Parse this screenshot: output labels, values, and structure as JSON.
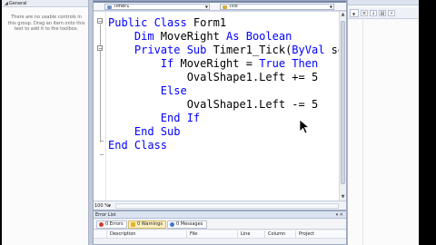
{
  "toolbox": {
    "title": "General",
    "empty_message": "There are no usable controls in\nthis group. Drag an item onto this\ntext to add it to the toolbox."
  },
  "editor": {
    "object_combo": "Timer1",
    "event_combo": "Tick",
    "zoom": "100 %",
    "code_lines": [
      {
        "tokens": [
          {
            "t": "Public Class ",
            "kw": true
          },
          {
            "t": "Form1",
            "kw": false
          }
        ]
      },
      {
        "tokens": [
          {
            "t": "    Dim ",
            "kw": true
          },
          {
            "t": "MoveRight ",
            "kw": false
          },
          {
            "t": "As Boolean",
            "kw": true
          }
        ]
      },
      {
        "tokens": [
          {
            "t": "    Private Sub ",
            "kw": true
          },
          {
            "t": "Timer1_Tick(",
            "kw": false
          },
          {
            "t": "ByVal",
            "kw": true
          },
          {
            "t": " se",
            "kw": false
          }
        ]
      },
      {
        "tokens": [
          {
            "t": "        If ",
            "kw": true
          },
          {
            "t": "MoveRight = ",
            "kw": false
          },
          {
            "t": "True Then",
            "kw": true
          }
        ]
      },
      {
        "tokens": [
          {
            "t": "            OvalShape1.Left += 5",
            "kw": false
          }
        ]
      },
      {
        "tokens": [
          {
            "t": "        Else",
            "kw": true
          }
        ]
      },
      {
        "tokens": [
          {
            "t": "            OvalShape1.Left -= 5",
            "kw": false
          }
        ]
      },
      {
        "tokens": [
          {
            "t": "        End If",
            "kw": true
          }
        ]
      },
      {
        "tokens": [
          {
            "t": "    End Sub",
            "kw": true
          }
        ]
      },
      {
        "tokens": [
          {
            "t": "End Class",
            "kw": true
          }
        ]
      }
    ]
  },
  "error_list": {
    "title": "Error List",
    "tabs": {
      "errors": "0 Errors",
      "warnings": "0 Warnings",
      "messages": "0 Messages"
    },
    "columns": {
      "description": "Description",
      "file": "File",
      "line": "Line",
      "column": "Column",
      "project": "Project"
    }
  },
  "colors": {
    "keyword": "#0000ff",
    "editor_bg": "#ffffff",
    "chrome": "#c9d3e2"
  }
}
